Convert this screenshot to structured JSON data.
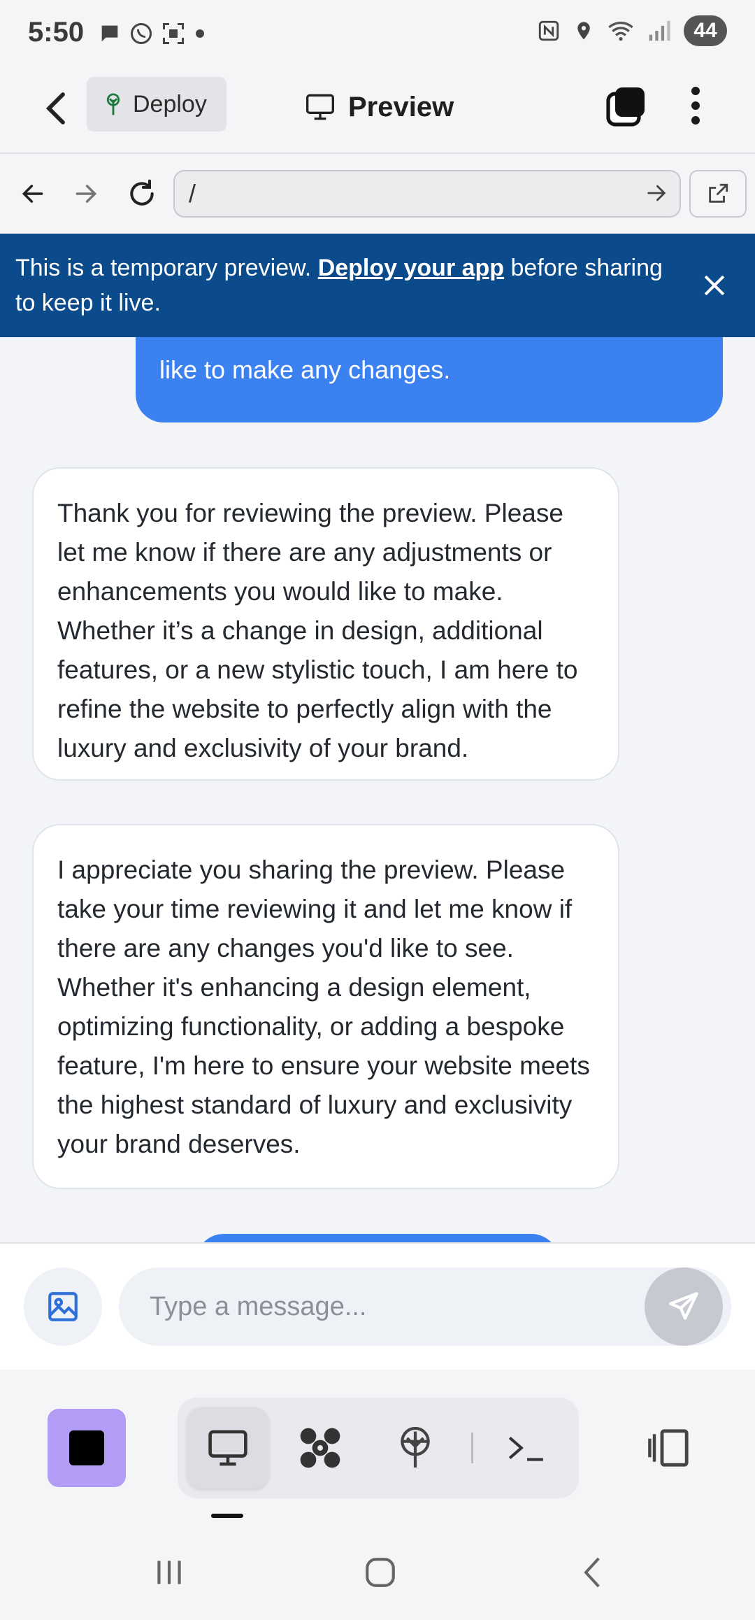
{
  "status_bar": {
    "time": "5:50",
    "battery": "44",
    "left_icons": [
      "chat-bubble-icon",
      "whatsapp-icon",
      "scan-icon",
      "dot-icon"
    ],
    "right_icons": [
      "nfc-icon",
      "location-icon",
      "wifi-icon",
      "signal-icon"
    ]
  },
  "header": {
    "deploy_label": "Deploy",
    "title": "Preview"
  },
  "browser": {
    "url": "/"
  },
  "banner": {
    "text_before": "This is a temporary preview. ",
    "link": "Deploy your app",
    "text_after": " before sharing to keep it live."
  },
  "chat": {
    "user_message_tail": "like to make any changes.",
    "messages": [
      "Thank you for reviewing the preview. Please let me know if there are any adjustments or enhancements you would like to make. Whether it’s a change in design, additional features, or a new stylistic touch, I am here to refine the website to perfectly align with the luxury and exclusivity of your brand.",
      "I appreciate you sharing the preview. Please take your time reviewing it and let me know if there are any changes you'd like to see. Whether it's enhancing a design element, optimizing functionality, or adding a bespoke feature, I'm here to ensure your website meets the highest standard of luxury and exclusivity your brand deserves."
    ]
  },
  "composer": {
    "placeholder": "Type a message..."
  },
  "colors": {
    "accent": "#3b82f0",
    "banner": "#0b4a8b",
    "stop": "#b39cf5"
  }
}
